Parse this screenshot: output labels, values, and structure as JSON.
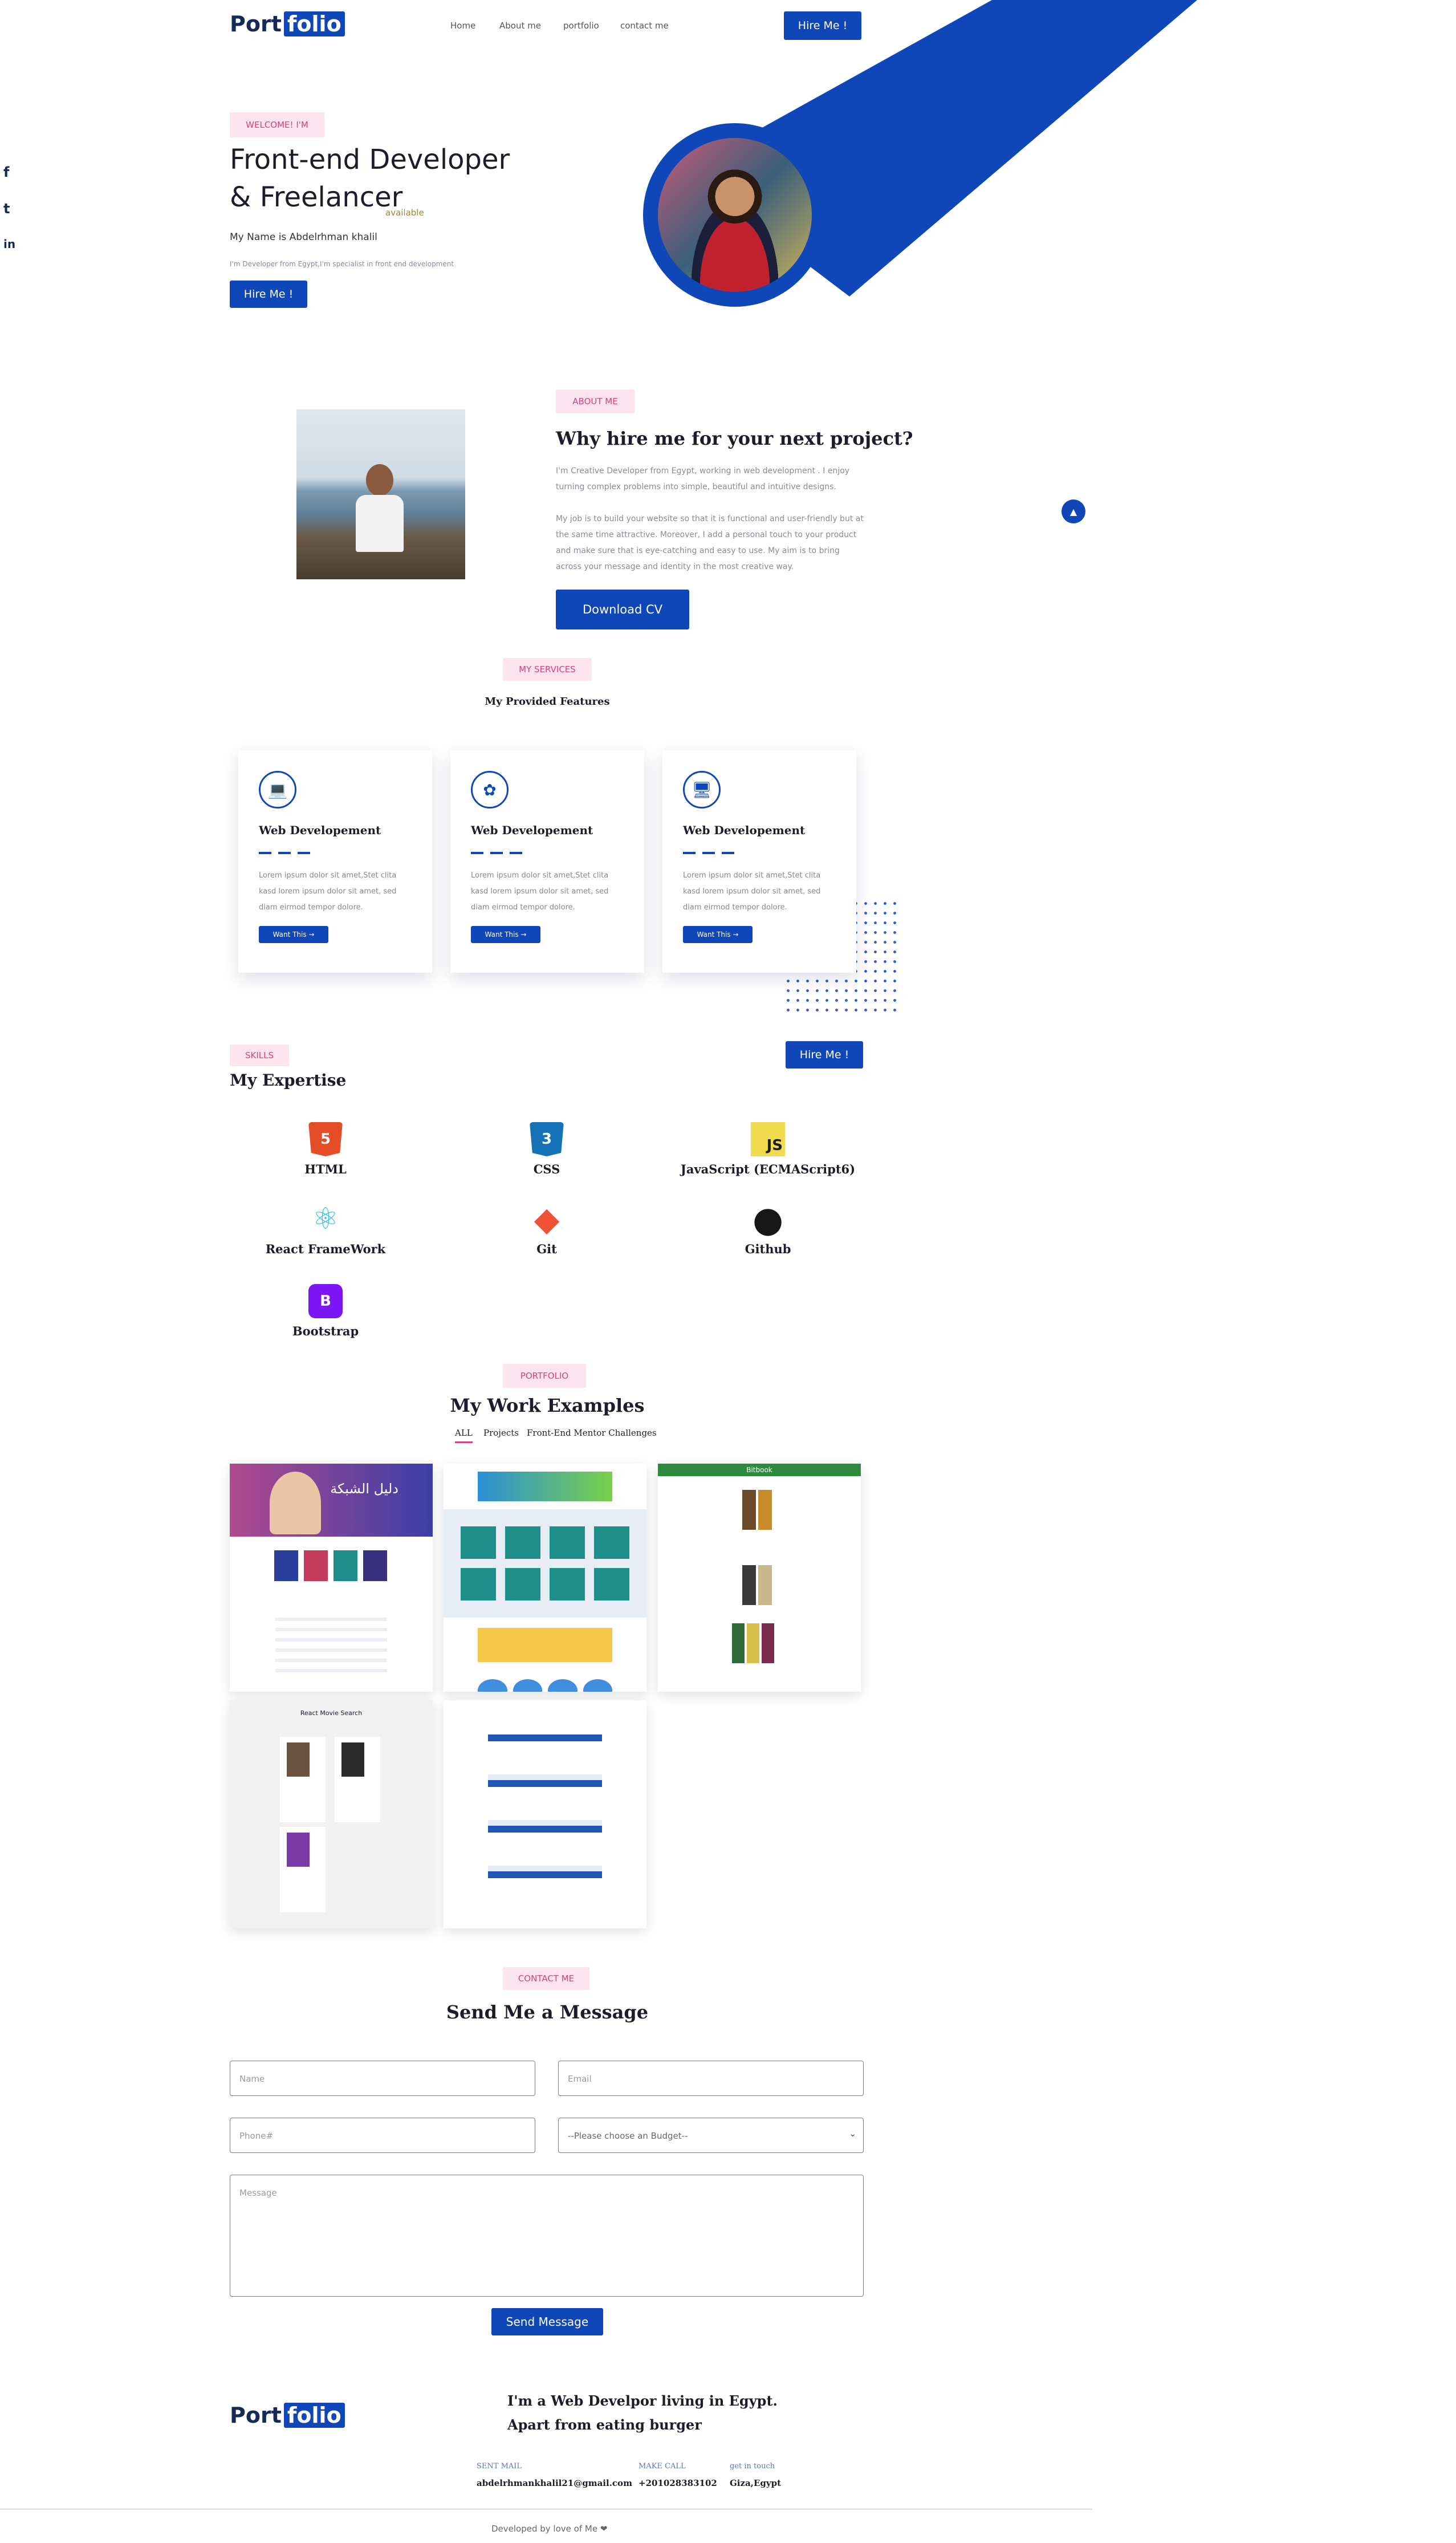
{
  "brand": {
    "part1": "Port",
    "part2": "folio"
  },
  "nav": {
    "home": "Home",
    "about": "About me",
    "portfolio": "portfolio",
    "contact": "contact me",
    "hire": "Hire Me !"
  },
  "social": {
    "facebook": "f",
    "twitter": "t",
    "linkedin": "in"
  },
  "hero": {
    "badge": "WELCOME! I'M",
    "title_line1": "Front-end Developer",
    "title_line2": "& Freelancer",
    "available": "available",
    "name": "My Name is Abdelrhman khalil",
    "desc": "I'm Developer from Egypt,I'm specialist in front end development",
    "hire": "Hire Me !"
  },
  "about": {
    "badge": "ABOUT ME",
    "title": "Why hire me for your next project?",
    "p1": "I'm Creative Developer from Egypt, working in web development . I enjoy turning complex problems into simple, beautiful and intuitive designs.",
    "p2": "My job is to build your website so that it is functional and user-friendly but at the same time attractive. Moreover, I add a personal touch to your product and make sure that is eye-catching and easy to use. My aim is to bring across your message and identity in the most creative way.",
    "download": "Download CV",
    "scroll_top": "▲"
  },
  "services": {
    "badge": "MY SERVICES",
    "title": "My Provided Features",
    "cards": [
      {
        "title": "Web Developement",
        "text": "Lorem ipsum dolor sit amet,Stet clita kasd lorem ipsum dolor sit amet, sed diam eirmod tempor dolore.",
        "button": "Want This →",
        "icon": "💻"
      },
      {
        "title": "Web Developement",
        "text": "Lorem ipsum dolor sit amet,Stet clita kasd lorem ipsum dolor sit amet, sed diam eirmod tempor dolore.",
        "button": "Want This →",
        "icon": "✿"
      },
      {
        "title": "Web Developement",
        "text": "Lorem ipsum dolor sit amet,Stet clita kasd lorem ipsum dolor sit amet, sed diam eirmod tempor dolore.",
        "button": "Want This →",
        "icon": "🖥"
      }
    ]
  },
  "skills": {
    "badge": "SKILLS",
    "title": "My Expertise",
    "hire": "Hire Me !",
    "items": [
      {
        "label": "HTML",
        "glyph": "5",
        "color": "#e44d26",
        "fg": "#ffffff"
      },
      {
        "label": "CSS",
        "glyph": "3",
        "color": "#1572b6",
        "fg": "#ffffff"
      },
      {
        "label": "JavaScript (ECMAScript6)",
        "glyph": "JS",
        "color": "#f0db4f",
        "fg": "#1c1c1c"
      },
      {
        "label": "React FrameWork",
        "glyph": "⚛",
        "color": "#ffffff",
        "fg": "#38bde0"
      },
      {
        "label": "Git",
        "glyph": "◆",
        "color": "#ffffff",
        "fg": "#f05033"
      },
      {
        "label": "Github",
        "glyph": "●",
        "color": "#ffffff",
        "fg": "#181717"
      },
      {
        "label": "Bootstrap",
        "glyph": "B",
        "color": "#7d16f5",
        "fg": "#ffffff"
      }
    ]
  },
  "portfolio": {
    "badge": "PORTFOLIO",
    "title": "My Work Examples",
    "tabs": [
      "ALL",
      "Projects",
      "Front-End Mentor Challenges"
    ],
    "shot1_heading": "دليل الشبكة",
    "shot3_heading": "Bitbook",
    "shot4_heading": "React Movie Search"
  },
  "contact": {
    "badge": "CONTACT ME",
    "title": "Send Me a Message",
    "name_ph": "Name",
    "email_ph": "Email",
    "phone_ph": "Phone#",
    "budget": "--Please choose an Budget--",
    "message_ph": "Message",
    "send": "Send Message"
  },
  "footer": {
    "tagline1": "I'm a Web Develpor living in Egypt.",
    "tagline2": "Apart from eating burger",
    "mail_label": "SENT MAIL",
    "mail": "abdelrhmankhalil21@gmail.com",
    "call_label": "MAKE CALL",
    "phone": "+201028383102",
    "touch_label": "get in touch",
    "location": "Giza,Egypt",
    "credit": "Developed by love of Me ❤"
  },
  "colors": {
    "accent": "#1047b8",
    "badge_bg": "#fbe4ee",
    "badge_fg": "#d6417f"
  }
}
